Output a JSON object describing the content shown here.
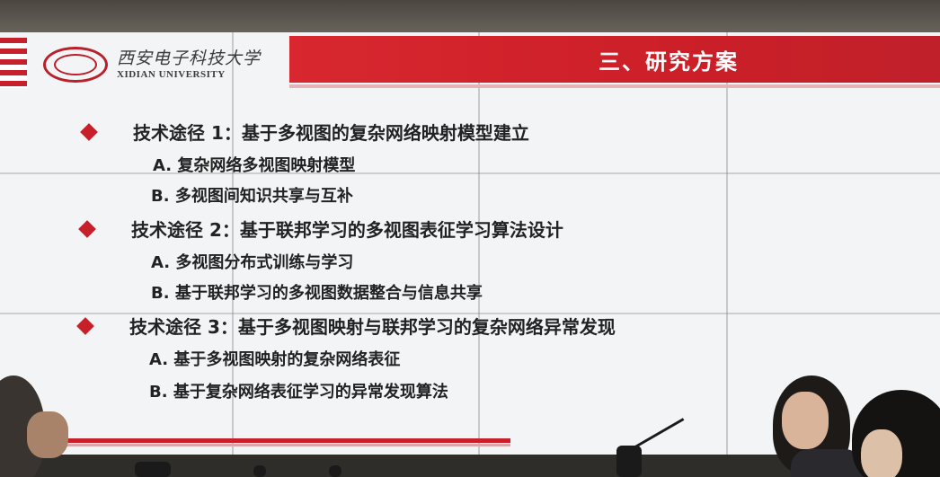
{
  "header": {
    "university_cn": "西安电子科技大学",
    "university_en": "XIDIAN UNIVERSITY",
    "section_title": "三、研究方案"
  },
  "items": [
    {
      "title": "技术途径 1：基于多视图的复杂网络映射模型建立",
      "subs": [
        "A. 复杂网络多视图映射模型",
        "B. 多视图间知识共享与互补"
      ]
    },
    {
      "title": "技术途径 2：基于联邦学习的多视图表征学习算法设计",
      "subs": [
        "A. 多视图分布式训练与学习",
        "B. 基于联邦学习的多视图数据整合与信息共享"
      ]
    },
    {
      "title": "技术途径 3：基于多视图映射与联邦学习的复杂网络异常发现",
      "subs": [
        "A. 基于多视图映射的复杂网络表征",
        "B. 基于复杂网络表征学习的异常发现算法"
      ]
    }
  ],
  "colors": {
    "accent_red": "#c8202a",
    "screen_bg": "#f3f4f6",
    "text": "#222222"
  }
}
